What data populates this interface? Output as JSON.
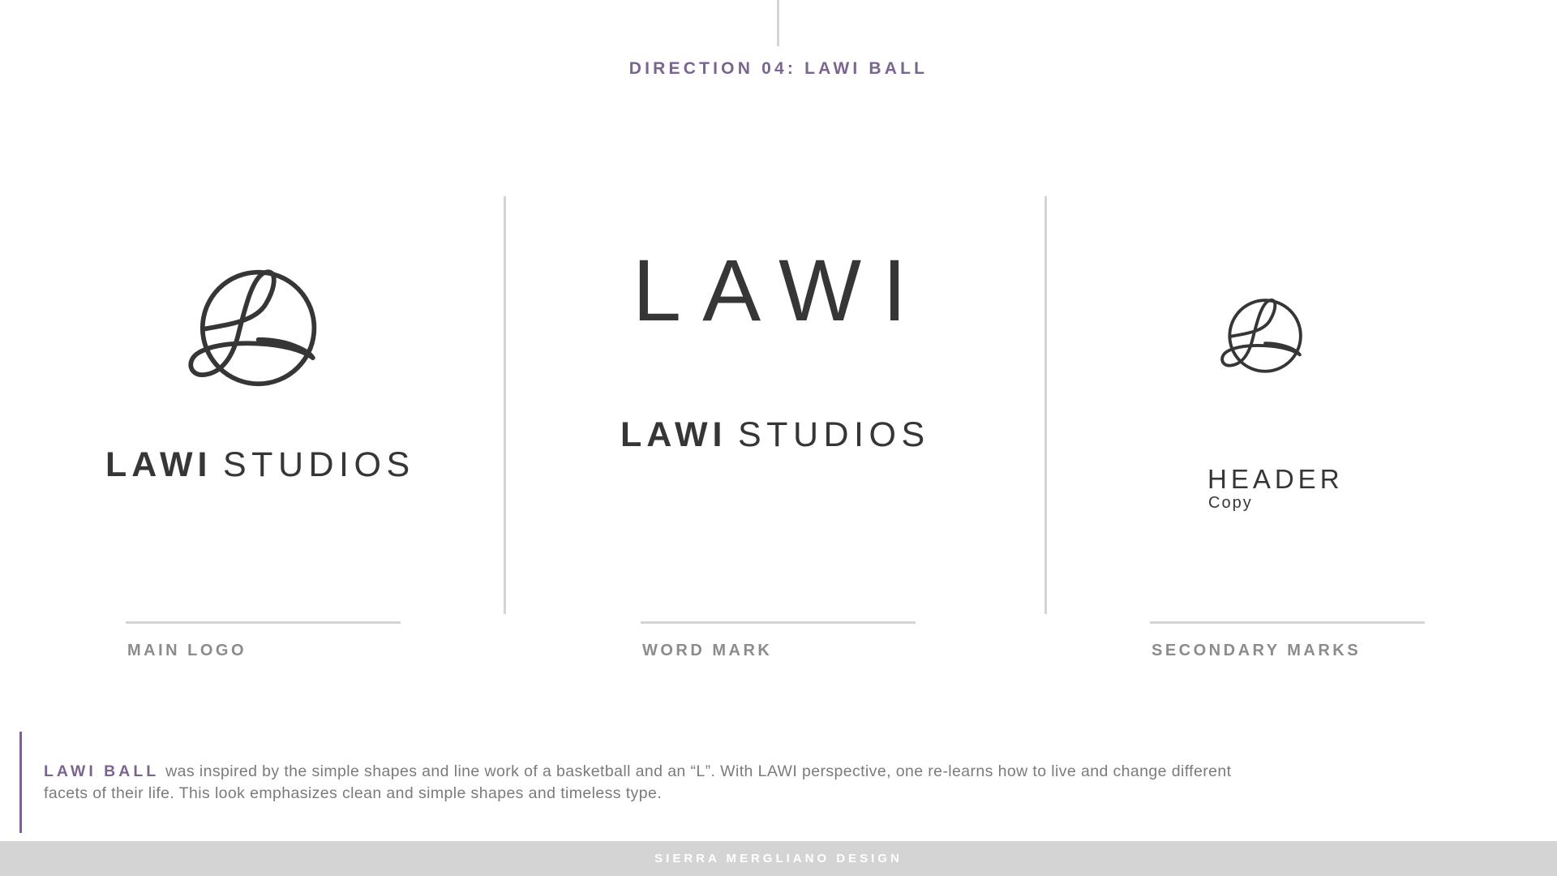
{
  "header": {
    "title": "DIRECTION 04: LAWI BALL"
  },
  "panels": {
    "main_logo": {
      "word_bold": "LAWI",
      "word_light": "STUDIOS",
      "caption": "MAIN LOGO"
    },
    "word_mark": {
      "big_word": "LAWI",
      "word_bold": "LAWI",
      "word_light": "STUDIOS",
      "caption": "WORD MARK"
    },
    "secondary_marks": {
      "header_sample": "HEADER",
      "copy_sample": "Copy",
      "caption": "SECONDARY MARKS"
    }
  },
  "description": {
    "lead": "LAWI BALL",
    "text": "was inspired by the simple shapes and line work of a basketball and an “L”. With LAWI perspective, one re-learns how to live and change different facets of their life. This look emphasizes clean and simple shapes and timeless type."
  },
  "footer": {
    "credit": "SIERRA MERGLIANO DESIGN"
  },
  "colors": {
    "accent_purple": "#7a6590",
    "logo_dark": "#363636",
    "caption_gray": "#8c8c8c",
    "rule_gray": "#d4d4d4",
    "footer_bg": "#d4d4d4"
  },
  "icons": {
    "ball_mark": "lawi-ball-icon"
  }
}
